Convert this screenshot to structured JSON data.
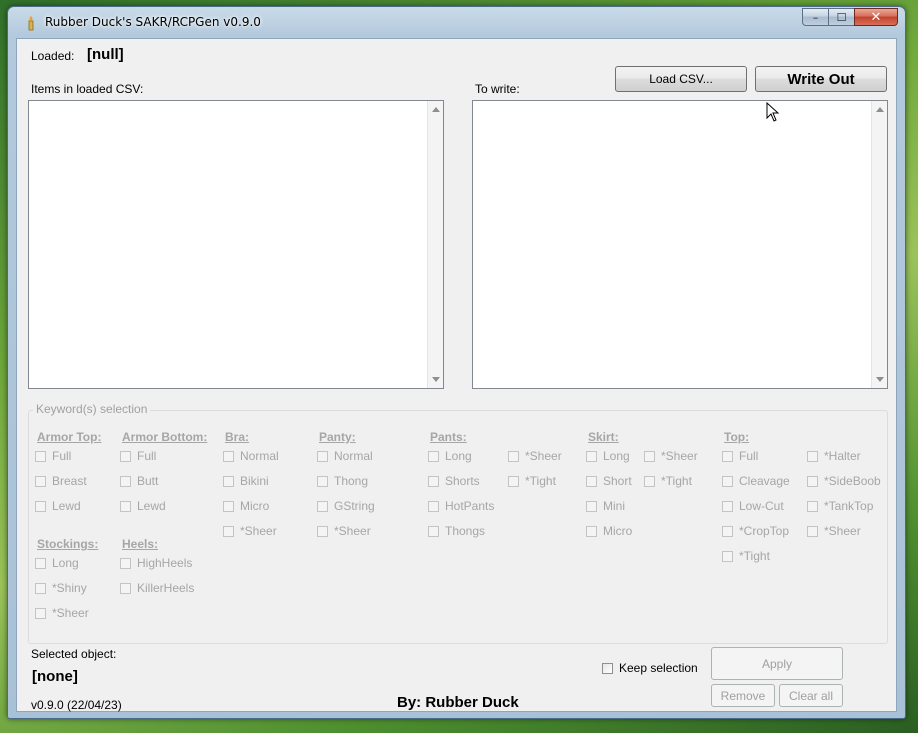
{
  "window": {
    "title": "Rubber Duck's SAKR/RCPGen v0.9.0",
    "minimize_label": "–",
    "maximize_label": "☐",
    "close_label": "✕"
  },
  "header": {
    "loaded_label": "Loaded:",
    "loaded_value": "[null]",
    "load_csv_label": "Load CSV...",
    "write_out_label": "Write Out"
  },
  "lists": {
    "items_label": "Items in loaded CSV:",
    "to_write_label": "To write:"
  },
  "keywords": {
    "legend": "Keyword(s) selection",
    "groups": {
      "armor_top": {
        "title": "Armor Top:",
        "options": [
          "Full",
          "Breast",
          "Lewd"
        ]
      },
      "armor_bottom": {
        "title": "Armor Bottom:",
        "options": [
          "Full",
          "Butt",
          "Lewd"
        ]
      },
      "bra": {
        "title": "Bra:",
        "options": [
          "Normal",
          "Bikini",
          "Micro",
          "*Sheer"
        ]
      },
      "panty": {
        "title": "Panty:",
        "options": [
          "Normal",
          "Thong",
          "GString",
          "*Sheer"
        ]
      },
      "pants": {
        "title": "Pants:",
        "options": [
          "Long",
          "Shorts",
          "HotPants",
          "Thongs",
          "*Sheer",
          "*Tight"
        ]
      },
      "skirt": {
        "title": "Skirt:",
        "options": [
          "Long",
          "Short",
          "Mini",
          "Micro",
          "*Sheer",
          "*Tight"
        ]
      },
      "top": {
        "title": "Top:",
        "options": [
          "Full",
          "Cleavage",
          "Low-Cut",
          "*CropTop",
          "*Tight",
          "*Halter",
          "*SideBoob",
          "*TankTop",
          "*Sheer"
        ]
      },
      "stockings": {
        "title": "Stockings:",
        "options": [
          "Long",
          "*Shiny",
          "*Sheer"
        ]
      },
      "heels": {
        "title": "Heels:",
        "options": [
          "HighHeels",
          "KillerHeels"
        ]
      }
    }
  },
  "footer": {
    "selected_label": "Selected object:",
    "selected_value": "[none]",
    "keep_selection_label": "Keep selection",
    "apply_label": "Apply",
    "remove_label": "Remove",
    "clear_all_label": "Clear all",
    "version": "v0.9.0 (22/04/23)",
    "author": "By: Rubber Duck"
  }
}
